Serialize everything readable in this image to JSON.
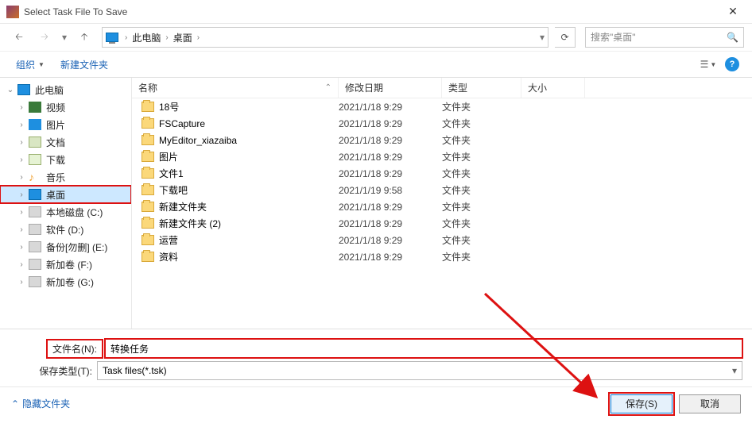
{
  "window": {
    "title": "Select Task File To Save"
  },
  "nav": {
    "breadcrumb": [
      "此电脑",
      "桌面"
    ],
    "search_placeholder": "搜索\"桌面\""
  },
  "toolbar": {
    "organize": "组织",
    "new_folder": "新建文件夹"
  },
  "sidebar": {
    "root": "此电脑",
    "items": [
      {
        "label": "视频",
        "icon": "video"
      },
      {
        "label": "图片",
        "icon": "pic"
      },
      {
        "label": "文档",
        "icon": "doc"
      },
      {
        "label": "下载",
        "icon": "down"
      },
      {
        "label": "音乐",
        "icon": "mus"
      },
      {
        "label": "桌面",
        "icon": "desk",
        "selected": true,
        "highlight": true
      },
      {
        "label": "本地磁盘 (C:)",
        "icon": "disk"
      },
      {
        "label": "软件 (D:)",
        "icon": "disk"
      },
      {
        "label": "备份[勿删] (E:)",
        "icon": "disk"
      },
      {
        "label": "新加卷 (F:)",
        "icon": "disk"
      },
      {
        "label": "新加卷 (G:)",
        "icon": "disk"
      }
    ]
  },
  "columns": {
    "name": "名称",
    "date": "修改日期",
    "type": "类型",
    "size": "大小"
  },
  "files": [
    {
      "name": "18号",
      "date": "2021/1/18 9:29",
      "type": "文件夹"
    },
    {
      "name": "FSCapture",
      "date": "2021/1/18 9:29",
      "type": "文件夹"
    },
    {
      "name": "MyEditor_xiazaiba",
      "date": "2021/1/18 9:29",
      "type": "文件夹"
    },
    {
      "name": "图片",
      "date": "2021/1/18 9:29",
      "type": "文件夹"
    },
    {
      "name": "文件1",
      "date": "2021/1/18 9:29",
      "type": "文件夹"
    },
    {
      "name": "下载吧",
      "date": "2021/1/19 9:58",
      "type": "文件夹"
    },
    {
      "name": "新建文件夹",
      "date": "2021/1/18 9:29",
      "type": "文件夹"
    },
    {
      "name": "新建文件夹 (2)",
      "date": "2021/1/18 9:29",
      "type": "文件夹"
    },
    {
      "name": "运营",
      "date": "2021/1/18 9:29",
      "type": "文件夹"
    },
    {
      "name": "资料",
      "date": "2021/1/18 9:29",
      "type": "文件夹"
    }
  ],
  "form": {
    "filename_label": "文件名(N):",
    "filename_value": "转换任务",
    "filetype_label": "保存类型(T):",
    "filetype_value": "Task files(*.tsk)"
  },
  "footer": {
    "hide_folders": "隐藏文件夹",
    "save": "保存(S)",
    "cancel": "取消"
  }
}
